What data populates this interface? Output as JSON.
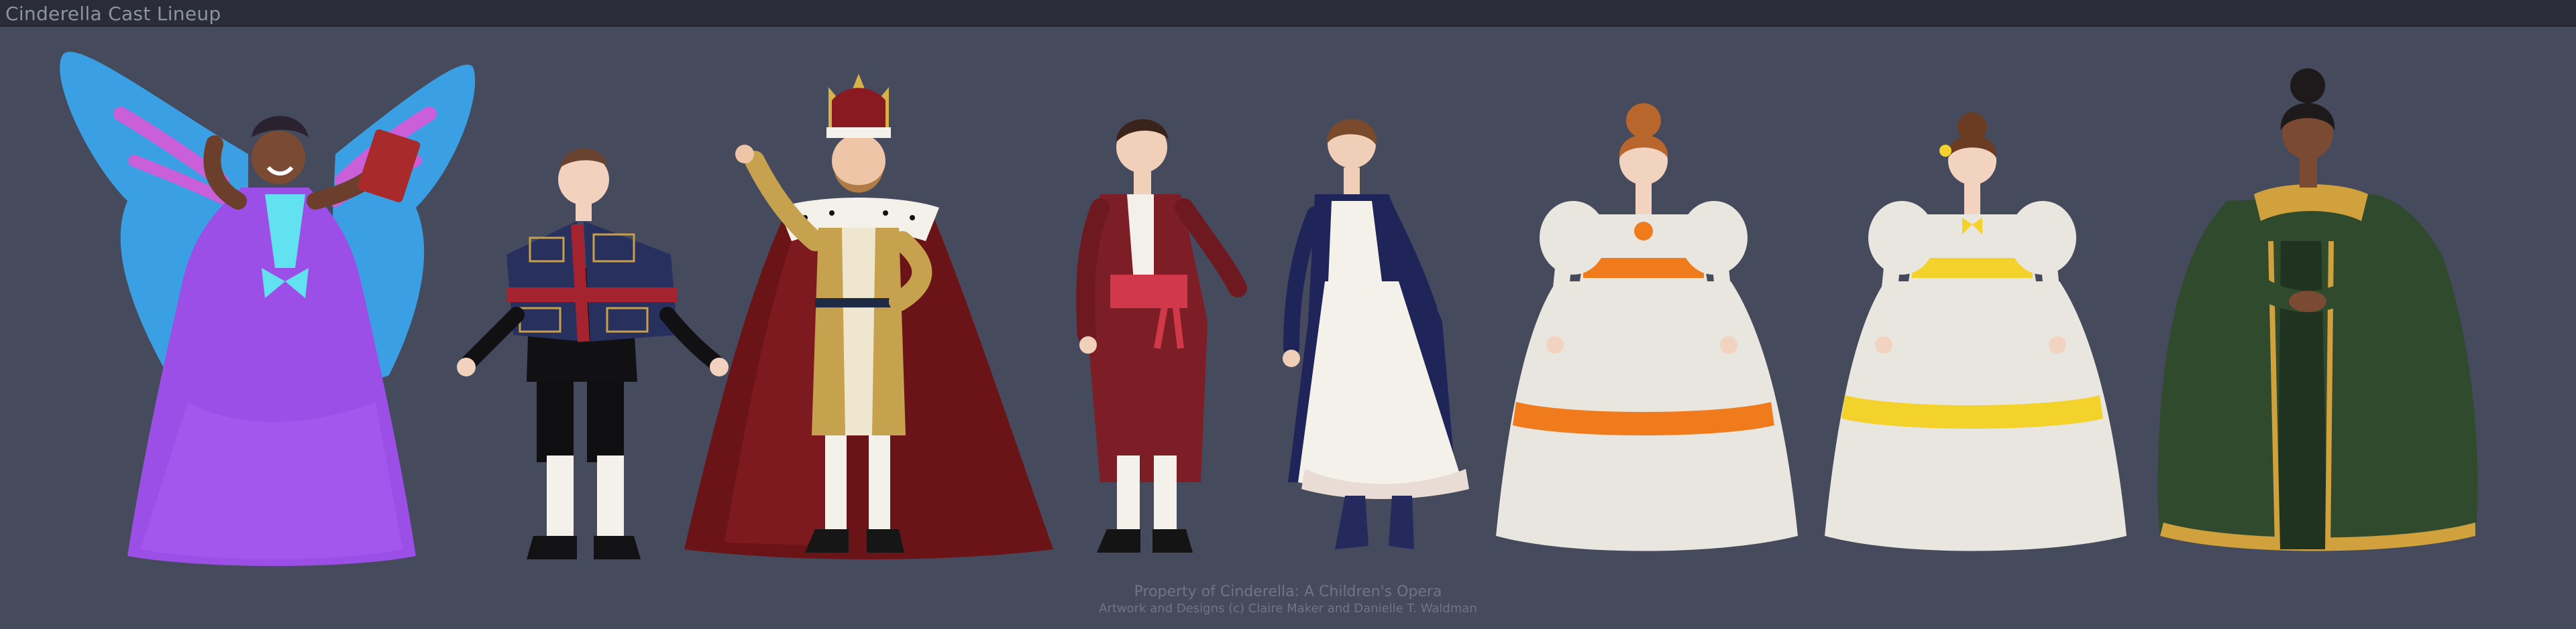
{
  "window": {
    "title": "Cinderella Cast Lineup"
  },
  "colors": {
    "background": "#454a5c",
    "titlebar": "#2a2d38",
    "title_text": "#8e93a3",
    "credit_text": "#6f7487"
  },
  "characters": [
    {
      "id": "fairy-godmother",
      "icon": "butterfly-winged-fairy"
    },
    {
      "id": "herald",
      "icon": "heraldic-tabard-figure"
    },
    {
      "id": "king",
      "icon": "crowned-king"
    },
    {
      "id": "prince",
      "icon": "prince-in-red"
    },
    {
      "id": "cinderella",
      "icon": "maid-in-apron"
    },
    {
      "id": "stepsister-orange",
      "icon": "gown-orange-sash"
    },
    {
      "id": "stepsister-yellow",
      "icon": "gown-yellow-sash"
    },
    {
      "id": "stepmother",
      "icon": "green-gown-woman"
    }
  ],
  "credits": {
    "line1": "Property of Cinderella: A Children's Opera",
    "line2": "Artwork and Designs (c) Claire Maker and Danielle T. Waldman"
  }
}
